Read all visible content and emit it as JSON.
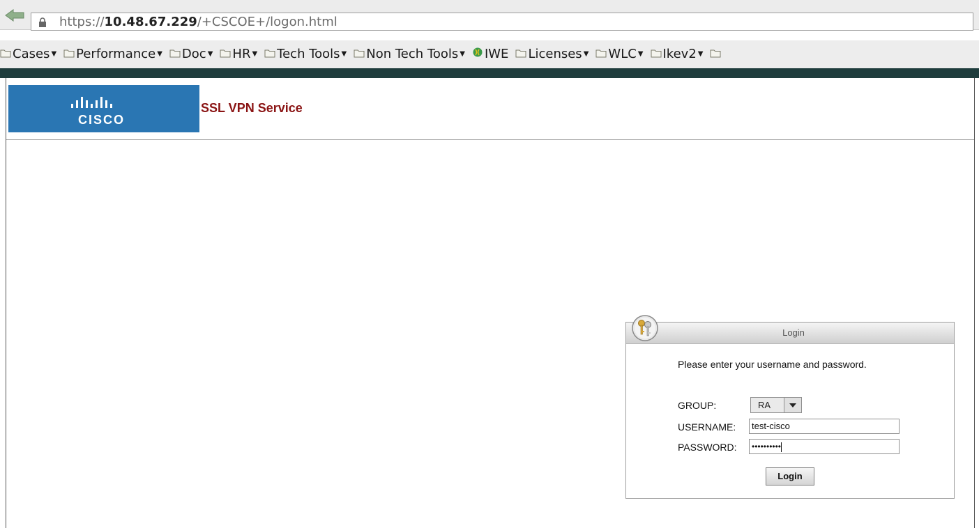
{
  "browser": {
    "url": {
      "scheme": "https://",
      "host": "10.48.67.229",
      "path": "/+CSCOE+/logon.html"
    },
    "bookmarks": [
      {
        "label": "Cases",
        "has_menu": true
      },
      {
        "label": "Performance",
        "has_menu": true
      },
      {
        "label": "Doc",
        "has_menu": true
      },
      {
        "label": "HR",
        "has_menu": true
      },
      {
        "label": "Tech Tools",
        "has_menu": true
      },
      {
        "label": "Non Tech Tools",
        "has_menu": true
      },
      {
        "label": "IWE",
        "has_menu": false
      },
      {
        "label": "Licenses",
        "has_menu": true
      },
      {
        "label": "WLC",
        "has_menu": true
      },
      {
        "label": "Ikev2",
        "has_menu": true
      }
    ]
  },
  "header": {
    "logo_text": "CISCO",
    "service_title": "SSL VPN Service"
  },
  "login": {
    "box_title": "Login",
    "prompt": "Please enter your username and password.",
    "group_label": "GROUP:",
    "group_value": "RA",
    "username_label": "USERNAME:",
    "username_value": "test-cisco",
    "password_label": "PASSWORD:",
    "password_mask": "••••••••••",
    "button_label": "Login"
  },
  "colors": {
    "cisco_blue": "#2a76b3",
    "service_title": "#8a1313",
    "toolbar_bar": "#1f3d3d"
  }
}
